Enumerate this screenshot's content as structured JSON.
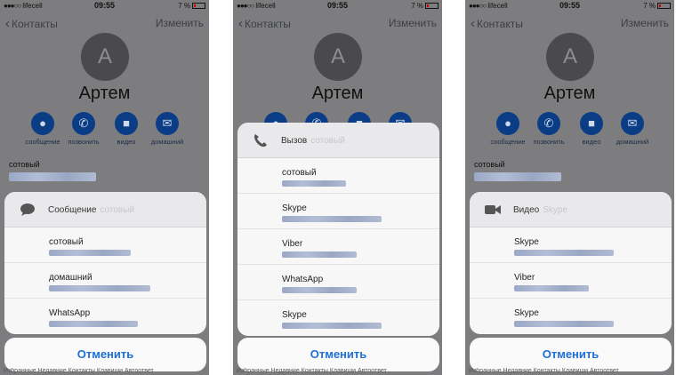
{
  "status": {
    "carrier": "lifecell",
    "time": "09:55",
    "battery": "7 %"
  },
  "nav": {
    "back": "Контакты",
    "edit": "Изменить"
  },
  "contact": {
    "initial": "A",
    "name": "Артем"
  },
  "actions": [
    "сообщение",
    "позвонить",
    "видео",
    "домашний"
  ],
  "mobile_label": "сотовый",
  "tabbar_text": "Избранные   Недавние   Контакты   Клавиши   Автоответ",
  "cancel": "Отменить",
  "sheets": [
    {
      "icon": "message-bubble-icon",
      "title": "Сообщение",
      "subtitle": "сотовый",
      "options": [
        "сотовый",
        "домашний",
        "WhatsApp"
      ]
    },
    {
      "icon": "phone-icon",
      "title": "Вызов",
      "subtitle": "сотовый",
      "options": [
        "сотовый",
        "Skype",
        "Viber",
        "WhatsApp",
        "Skype"
      ]
    },
    {
      "icon": "video-camera-icon",
      "title": "Видео",
      "subtitle": "Skype",
      "options": [
        "Skype",
        "Viber",
        "Skype"
      ]
    }
  ],
  "colors": {
    "accent": "#1e6fd6",
    "action_circle": "#0a3d86",
    "dim_background": "#7d7d7f"
  }
}
